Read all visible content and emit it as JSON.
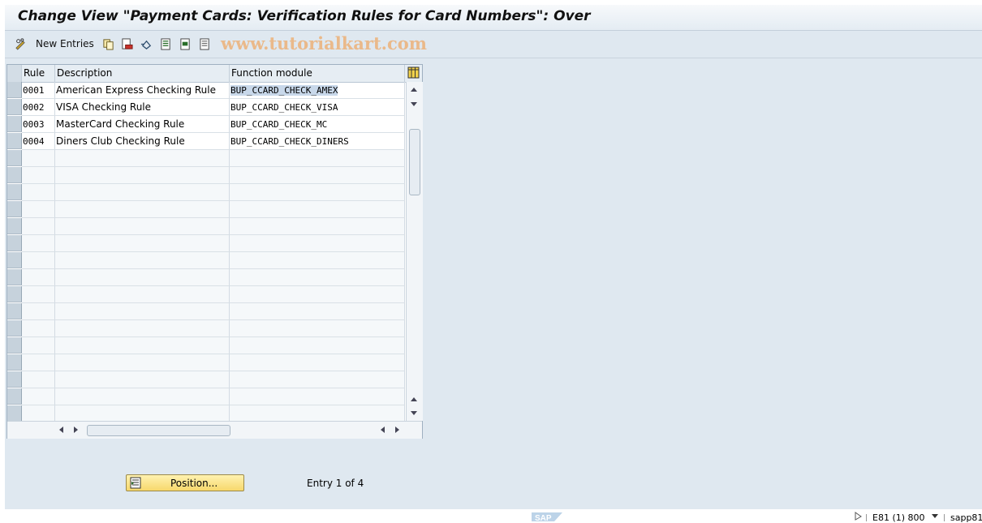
{
  "window": {
    "title": "Change View \"Payment Cards: Verification Rules for Card Numbers\": Over"
  },
  "toolbar": {
    "new_entries_label": "New Entries",
    "watermark": "www.tutorialkart.com",
    "icons": [
      "pencil-glasses-icon",
      "copy-icon",
      "delete-icon",
      "undo-icon",
      "select-all-icon",
      "select-block-icon",
      "deselect-all-icon"
    ]
  },
  "table": {
    "columns": [
      "Rule",
      "Description",
      "Function module"
    ],
    "rows": [
      {
        "rule": "0001",
        "description": "American Express Checking Rule",
        "function_module": "BUP_CCARD_CHECK_AMEX"
      },
      {
        "rule": "0002",
        "description": "VISA Checking Rule",
        "function_module": "BUP_CCARD_CHECK_VISA"
      },
      {
        "rule": "0003",
        "description": "MasterCard Checking Rule",
        "function_module": "BUP_CCARD_CHECK_MC"
      },
      {
        "rule": "0004",
        "description": "Diners Club Checking Rule",
        "function_module": "BUP_CCARD_CHECK_DINERS"
      }
    ],
    "empty_rows": 16
  },
  "footer": {
    "position_button_label": "Position...",
    "entry_info": "Entry 1 of 4"
  },
  "status_bar": {
    "brand": "SAP",
    "system": "E81 (1) 800",
    "server": "sapp81"
  },
  "colors": {
    "background": "#dfe8f0",
    "title_bar": "#e4ecf3",
    "highlight": "#c8d8ea",
    "position_button": "#f7d86c",
    "watermark": "#eab98a"
  }
}
